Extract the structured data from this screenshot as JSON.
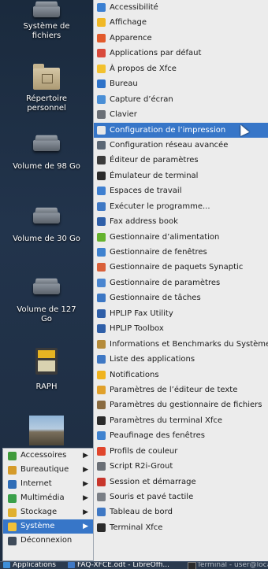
{
  "desktop": {
    "items": [
      {
        "label": "Système de fichiers",
        "icon": "filesystem-drive-icon"
      },
      {
        "label": "Répertoire personnel",
        "icon": "home-folder-icon"
      },
      {
        "label": "Volume de 98 Go",
        "icon": "drive-icon"
      },
      {
        "label": "Volume de 30 Go",
        "icon": "drive-icon"
      },
      {
        "label": "Volume de 127 Go",
        "icon": "drive-icon"
      },
      {
        "label": "RAPH",
        "icon": "sdcard-icon"
      },
      {
        "label": "",
        "icon": "image-thumbnail-icon"
      }
    ]
  },
  "categories": [
    {
      "label": "Accessoires",
      "color": "#3f9a3a",
      "arrow": "▶"
    },
    {
      "label": "Bureautique",
      "color": "#d59b2a",
      "arrow": "▶"
    },
    {
      "label": "Internet",
      "color": "#2f6db7",
      "arrow": "▶"
    },
    {
      "label": "Multimédia",
      "color": "#3aa04a",
      "arrow": "▶"
    },
    {
      "label": "Stockage",
      "color": "#e0b030",
      "arrow": "▶"
    },
    {
      "label": "Système",
      "color": "#f0c13a",
      "arrow": "▶",
      "active": true
    },
    {
      "label": "Déconnexion",
      "color": "#3f4b5a",
      "arrow": ""
    }
  ],
  "menu": {
    "items": [
      {
        "label": "Accessibilité",
        "color": "#3b7fd1"
      },
      {
        "label": "Affichage",
        "color": "#f0b826"
      },
      {
        "label": "Apparence",
        "color": "#e25a2c"
      },
      {
        "label": "Applications par défaut",
        "color": "#d94a3c"
      },
      {
        "label": "À propos de Xfce",
        "color": "#f2c12e"
      },
      {
        "label": "Bureau",
        "color": "#2e73c9"
      },
      {
        "label": "Capture d’écran",
        "color": "#4a8fd6"
      },
      {
        "label": "Clavier",
        "color": "#6a6f76"
      },
      {
        "label": "Configuration de l’impression",
        "color": "#e8e8e8"
      },
      {
        "label": "Configuration réseau avancée",
        "color": "#5b6775"
      },
      {
        "label": "Éditeur de paramètres",
        "color": "#3c3c3c"
      },
      {
        "label": "Émulateur de terminal",
        "color": "#2b2b2b"
      },
      {
        "label": "Espaces de travail",
        "color": "#3e7fd0"
      },
      {
        "label": "Exécuter le programme...",
        "color": "#3f78c4"
      },
      {
        "label": "Fax address book",
        "color": "#2f5fa8"
      },
      {
        "label": "Gestionnaire d’alimentation",
        "color": "#65b32e"
      },
      {
        "label": "Gestionnaire de fenêtres",
        "color": "#3f82cf"
      },
      {
        "label": "Gestionnaire de paquets Synaptic",
        "color": "#d9603a"
      },
      {
        "label": "Gestionnaire de paramètres",
        "color": "#4a86d0"
      },
      {
        "label": "Gestionnaire de tâches",
        "color": "#3c77c4"
      },
      {
        "label": "HPLIP Fax Utility",
        "color": "#2f5fa8"
      },
      {
        "label": "HPLIP Toolbox",
        "color": "#2f5fa8"
      },
      {
        "label": "Informations et Benchmarks du Système",
        "color": "#b58b3a"
      },
      {
        "label": "Liste des applications",
        "color": "#3f78c4"
      },
      {
        "label": "Notifications",
        "color": "#f0b31e"
      },
      {
        "label": "Paramètres de l’éditeur de texte",
        "color": "#e0a02a"
      },
      {
        "label": "Paramètres du gestionnaire de fichiers",
        "color": "#8a6b40"
      },
      {
        "label": "Paramètres du terminal Xfce",
        "color": "#2b2b2b"
      },
      {
        "label": "Peaufinage des fenêtres",
        "color": "#3f82cf"
      },
      {
        "label": "Profils de couleur",
        "color": "#e0452c"
      },
      {
        "label": "Script R2i-Grout",
        "color": "#6a6f76"
      },
      {
        "label": "Session et démarrage",
        "color": "#c8362c"
      },
      {
        "label": "Souris et pavé tactile",
        "color": "#7a7f86"
      },
      {
        "label": "Tableau de bord",
        "color": "#3f78c4"
      },
      {
        "label": "Terminal Xfce",
        "color": "#2b2b2b"
      }
    ],
    "highlighted_index": 8
  },
  "taskbar": {
    "items": [
      {
        "label": "Applications",
        "color": "#3f8fd8"
      },
      {
        "label": "FAQ-XFCE.odt - LibreOffi...",
        "color": "#3f78c4"
      },
      {
        "label": "Terminal - user@locall",
        "color": "#2b2b2b"
      }
    ]
  }
}
